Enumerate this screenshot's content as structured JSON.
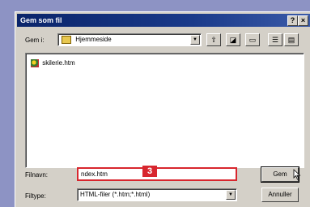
{
  "dialog": {
    "title": "Gem som fil",
    "help_label": "?",
    "close_label": "×",
    "save_in_label": "Gem i:",
    "save_in_value": "Hjemmeside",
    "toolbar": [
      "up-one-level",
      "desktop",
      "new-folder",
      "list-view",
      "details-view"
    ],
    "files": [
      "skilerie.htm"
    ],
    "filename_label": "Filnavn:",
    "filename_value": "ndex.htm",
    "filetype_label": "Filtype:",
    "filetype_value": "HTML-filer (*.htm;*.html)",
    "save_button": "Gem",
    "cancel_button": "Annuller",
    "callout_number": "3"
  },
  "colors": {
    "desktop": "#8d93c4",
    "titlebar": "#0a246a",
    "highlight": "#d8262e"
  }
}
